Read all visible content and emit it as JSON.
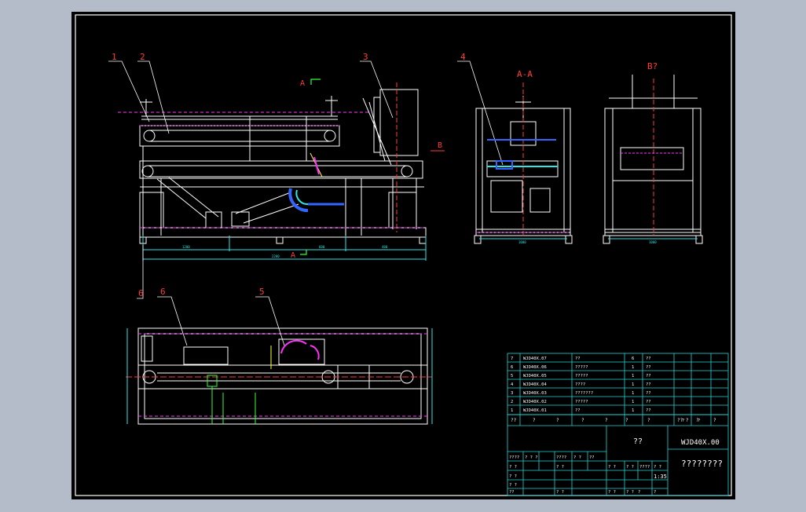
{
  "drawing": {
    "balloons": [
      "1",
      "2",
      "3",
      "4",
      "5",
      "6",
      "6"
    ],
    "section_a": "A",
    "section_a2": "A",
    "section_b": "B",
    "view_aa_title": "A-A",
    "view_b_title": "B?",
    "dims_front": [
      "1200",
      "2280",
      "480",
      "600"
    ],
    "dim_aa": "1000",
    "dim_bb": "1000"
  },
  "colors": {
    "background": "#000000",
    "border": "#ffffff",
    "geometry": "#ffffff",
    "leaders": "#ff3b3b",
    "magenta": "#ff33ff",
    "cyan": "#2ee6e6",
    "blue": "#3366ff",
    "yellow": "#ffff33",
    "green": "#33ff33",
    "table": "#25d5d5"
  },
  "bom": {
    "rows": [
      {
        "no": "7",
        "code": "WJD40X.07",
        "name": "??",
        "qty": "6",
        "mat": "??"
      },
      {
        "no": "6",
        "code": "WJD40X.06",
        "name": "?????",
        "qty": "1",
        "mat": "??"
      },
      {
        "no": "5",
        "code": "WJD40X.05",
        "name": "?????",
        "qty": "1",
        "mat": "??"
      },
      {
        "no": "4",
        "code": "WJD40X.04",
        "name": "????",
        "qty": "1",
        "mat": "??"
      },
      {
        "no": "3",
        "code": "WJD40X.03",
        "name": "???????",
        "qty": "1",
        "mat": "??"
      },
      {
        "no": "2",
        "code": "WJD40X.02",
        "name": "?????",
        "qty": "1",
        "mat": "??"
      },
      {
        "no": "1",
        "code": "WJD40X.01",
        "name": "??",
        "qty": "1",
        "mat": "??"
      }
    ],
    "header": [
      "??",
      "?",
      "?",
      "?",
      "?",
      "?",
      "?",
      "?? ?",
      "?",
      "?"
    ]
  },
  "title_block": {
    "part_name": "??",
    "drawing_no": "WJD40X.00",
    "company": "????????",
    "scale": "1:35",
    "labels": [
      "????",
      "? ? ?",
      "????",
      "? ?",
      "??",
      "? ?",
      "? ?",
      "? ?",
      "? ?",
      "? ?",
      "??",
      "? ?",
      "? ?",
      "????",
      "? ?",
      "? ?",
      "? ?",
      "?",
      "?",
      "?",
      "?"
    ]
  }
}
